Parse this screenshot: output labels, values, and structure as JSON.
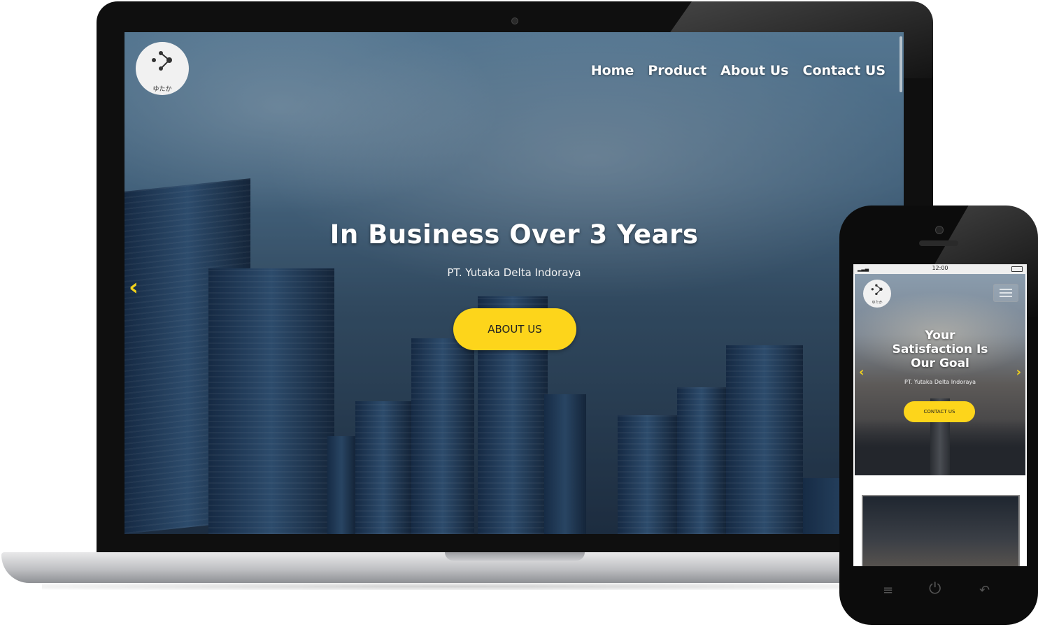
{
  "desktop": {
    "logo": {
      "icon": "logo-dots-arrow-icon",
      "text": "ゆたか"
    },
    "nav": [
      {
        "label": "Home"
      },
      {
        "label": "Product"
      },
      {
        "label": "About Us"
      },
      {
        "label": "Contact US"
      }
    ],
    "hero": {
      "title": "In Business Over 3 Years",
      "subtitle": "PT. Yutaka Delta Indoraya",
      "button_label": "ABOUT US",
      "prev_arrow": "‹"
    }
  },
  "mobile": {
    "status_time": "12:00",
    "logo": {
      "icon": "logo-dots-arrow-icon",
      "text": "ゆたか"
    },
    "hero": {
      "title_lines": [
        "Your",
        "Satisfaction Is",
        "Our Goal"
      ],
      "subtitle": "PT. Yutaka Delta Indoraya",
      "button_label": "CONTACT US",
      "prev_arrow": "‹",
      "next_arrow": "›"
    },
    "nav_icons": [
      "menu-icon",
      "power-icon",
      "back-icon"
    ]
  },
  "colors": {
    "accent": "#fdd51b",
    "arrow": "#f2d21b",
    "device": "#0f0f0f"
  }
}
